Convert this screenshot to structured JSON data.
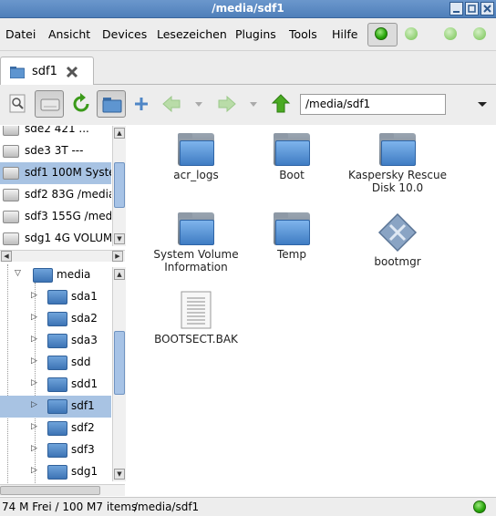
{
  "window": {
    "title": "/media/sdf1"
  },
  "menu": [
    "Datei",
    "Ansicht",
    "Devices",
    "Lesezeichen",
    "Plugins",
    "Tools",
    "Hilfe"
  ],
  "tab": {
    "label": "sdf1"
  },
  "toolbar": {
    "location": "/media/sdf1"
  },
  "drives": [
    {
      "label": "sde2 421 ..."
    },
    {
      "label": "sde3 3T ---"
    },
    {
      "label": "sdf1 100M Syste",
      "selected": true
    },
    {
      "label": "sdf2 83G /media"
    },
    {
      "label": "sdf3 155G /medi"
    },
    {
      "label": "sdg1 4G VOLUM"
    }
  ],
  "tree": {
    "root": "media",
    "children": [
      {
        "label": "sda1"
      },
      {
        "label": "sda2"
      },
      {
        "label": "sda3"
      },
      {
        "label": "sdd"
      },
      {
        "label": "sdd1"
      },
      {
        "label": "sdf1",
        "selected": true
      },
      {
        "label": "sdf2"
      },
      {
        "label": "sdf3"
      },
      {
        "label": "sdg1"
      }
    ]
  },
  "files": [
    {
      "name": "acr_logs",
      "type": "folder"
    },
    {
      "name": "Boot",
      "type": "folder"
    },
    {
      "name": "Kaspersky Rescue Disk 10.0",
      "type": "folder"
    },
    {
      "name": "System Volume Information",
      "type": "folder"
    },
    {
      "name": "Temp",
      "type": "folder"
    },
    {
      "name": "bootmgr",
      "type": "executable"
    },
    {
      "name": "BOOTSECT.BAK",
      "type": "document"
    }
  ],
  "status": {
    "left": "74 M Frei / 100 M7 items",
    "path": "/media/sdf1"
  },
  "colors": {
    "titlebar": "#5a88c2",
    "selection": "#a8c3e3",
    "led_on": "#27a50a"
  }
}
